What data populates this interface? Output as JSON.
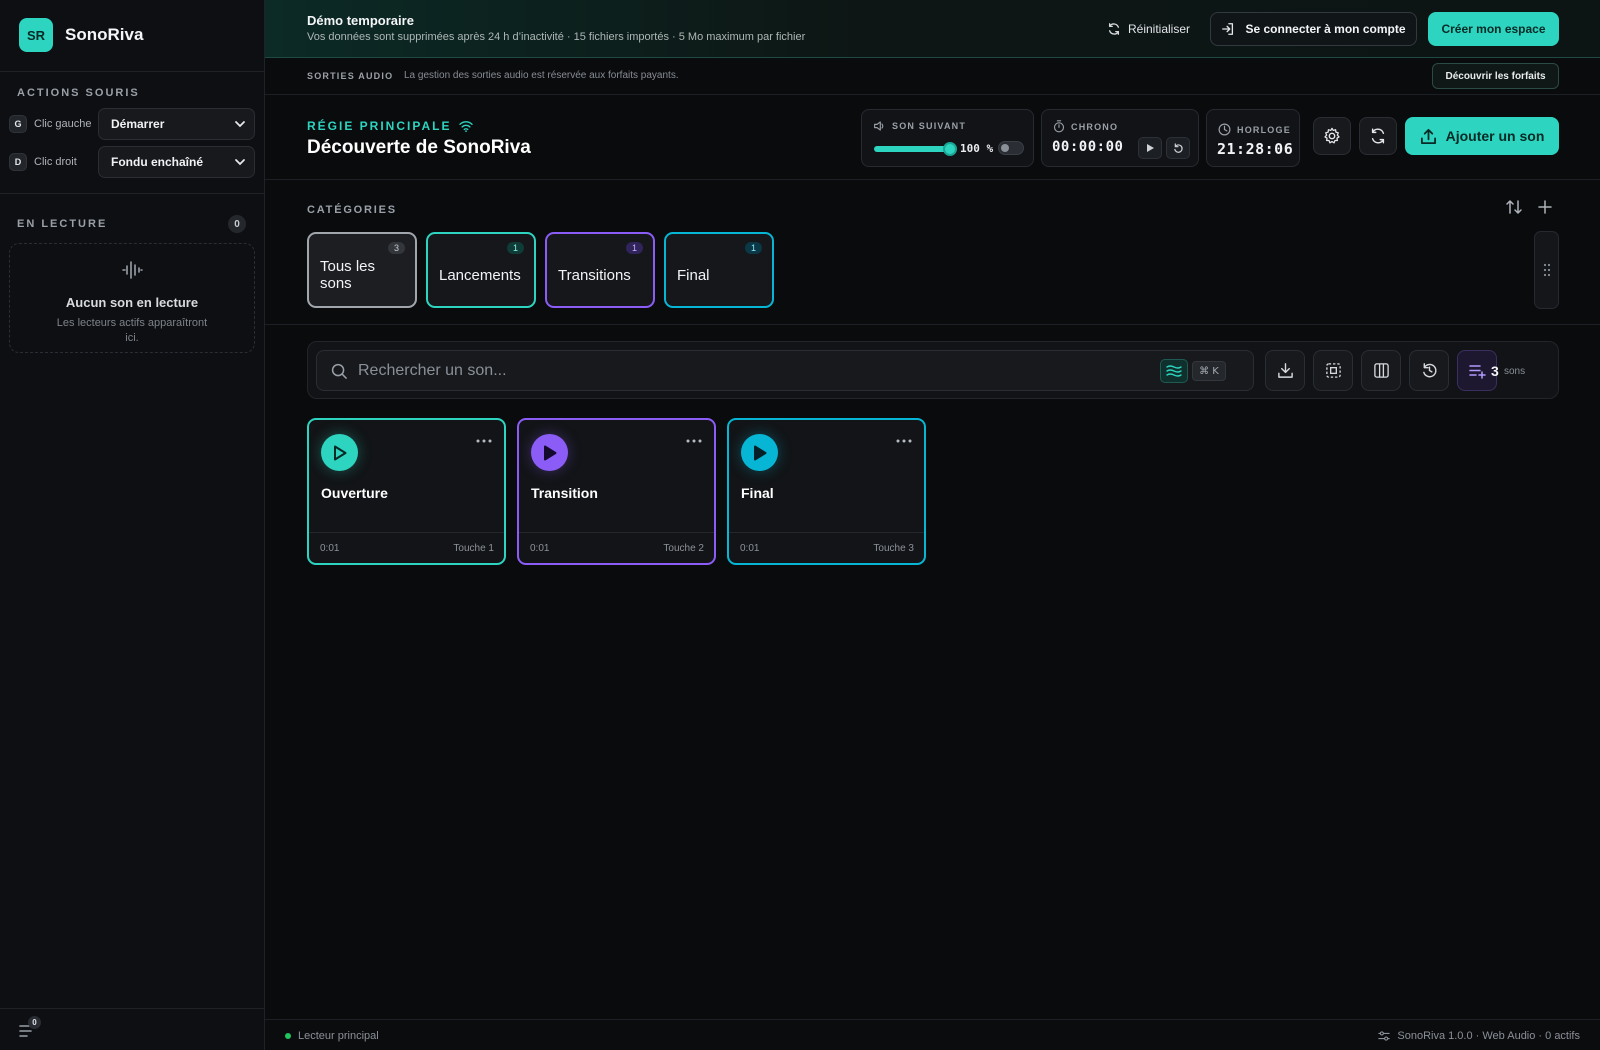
{
  "app": {
    "logo": "SR",
    "name": "SonoRiva"
  },
  "sidebar": {
    "mouse_heading": "ACTIONS SOURIS",
    "left_click": {
      "key": "G",
      "label": "Clic gauche",
      "value": "Démarrer",
      "icon": "chevron-down-icon"
    },
    "right_click": {
      "key": "D",
      "label": "Clic droit",
      "value": "Fondu enchaîné",
      "icon": "chevron-down-icon"
    },
    "playing_heading": "EN LECTURE",
    "playing_count": "0",
    "empty_title": "Aucun son en lecture",
    "empty_sub": "Les lecteurs actifs apparaîtront ici.",
    "queue_badge": "0"
  },
  "demo": {
    "title": "Démo temporaire",
    "subtitle": "Vos données sont supprimées après 24 h d’inactivité · 15 fichiers importés · 5 Mo maximum par fichier",
    "reset_label": "Réinitialiser",
    "login_label": "Se connecter à mon compte",
    "create_label": "Créer mon espace"
  },
  "outputs": {
    "label": "SORTIES AUDIO",
    "text": "La gestion des sorties audio est réservée aux forfaits payants.",
    "plans_label": "Découvrir les forfaits"
  },
  "header": {
    "regie_label": "RÉGIE PRINCIPALE",
    "title": "Découverte de SonoRiva",
    "next_sound": {
      "label": "SON SUIVANT",
      "volume": "100 %",
      "volume_level": 1.0,
      "toggle_on": false
    },
    "chrono": {
      "label": "CHRONO",
      "time": "00:00:00"
    },
    "clock": {
      "label": "HORLOGE",
      "time": "21:28:06"
    },
    "add_label": "Ajouter un son"
  },
  "categories": {
    "label": "CATÉGORIES",
    "items": [
      {
        "name": "Tous les sons",
        "count": "3",
        "color": "#a1a6ad",
        "selected": true
      },
      {
        "name": "Lancements",
        "count": "1",
        "color": "#2dd4bf"
      },
      {
        "name": "Transitions",
        "count": "1",
        "color": "#8b5cf6"
      },
      {
        "name": "Final",
        "count": "1",
        "color": "#06b6d4"
      }
    ]
  },
  "search": {
    "placeholder": "Rechercher un son...",
    "shortcut": "⌘ K",
    "count": "3",
    "count_label": "sons"
  },
  "sounds": [
    {
      "title": "Ouverture",
      "duration": "0:01",
      "key": "Touche 1",
      "color": "#2dd4bf"
    },
    {
      "title": "Transition",
      "duration": "0:01",
      "key": "Touche 2",
      "color": "#8b5cf6"
    },
    {
      "title": "Final",
      "duration": "0:01",
      "key": "Touche 3",
      "color": "#06b6d4"
    }
  ],
  "status": {
    "left": "Lecteur principal",
    "right": "SonoRiva 1.0.0 · Web Audio · 0 actifs"
  }
}
